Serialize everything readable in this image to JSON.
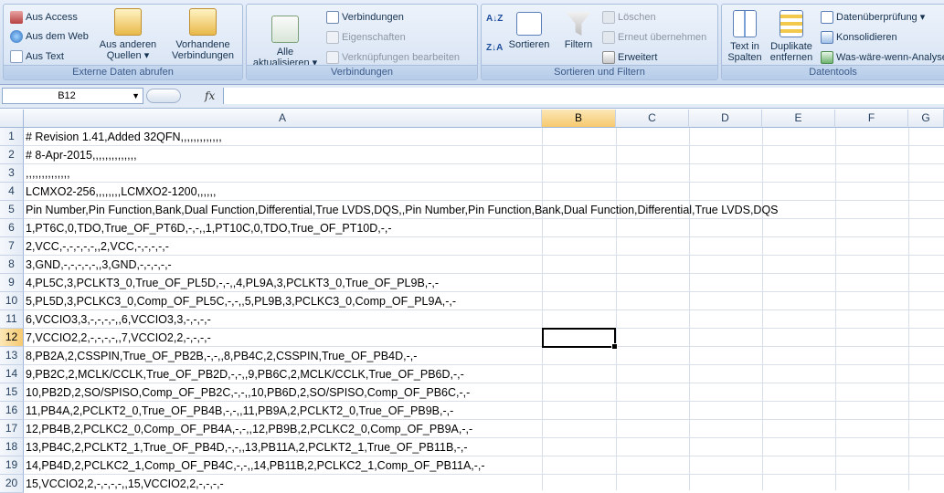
{
  "ribbon": {
    "external": {
      "title": "Externe Daten abrufen",
      "access": "Aus Access",
      "web": "Aus dem Web",
      "text": "Aus Text",
      "other_line1": "Aus anderen",
      "other_line2": "Quellen ▾",
      "existing_line1": "Vorhandene",
      "existing_line2": "Verbindungen"
    },
    "connections": {
      "title": "Verbindungen",
      "refresh_line1": "Alle",
      "refresh_line2": "aktualisieren ▾",
      "connections": "Verbindungen",
      "properties": "Eigenschaften",
      "edit_links": "Verknüpfungen bearbeiten"
    },
    "sort": {
      "title": "Sortieren und Filtern",
      "sort": "Sortieren",
      "filter": "Filtern",
      "clear": "Löschen",
      "reapply": "Erneut übernehmen",
      "advanced": "Erweitert"
    },
    "tools": {
      "title": "Datentools",
      "text_to_cols_line1": "Text in",
      "text_to_cols_line2": "Spalten",
      "dup_line1": "Duplikate",
      "dup_line2": "entfernen",
      "validation": "Datenüberprüfung ▾",
      "consolidate": "Konsolidieren",
      "whatif": "Was-wäre-wenn-Analyse"
    }
  },
  "formula_bar": {
    "name_box": "B12",
    "fx": "fx",
    "content": ""
  },
  "columns": [
    "A",
    "B",
    "C",
    "D",
    "E",
    "F",
    "G"
  ],
  "selected_column": "B",
  "selected_row": "12",
  "rows": [
    {
      "n": "1",
      "a": "# Revision 1.41,Added 32QFN,,,,,,,,,,,,,"
    },
    {
      "n": "2",
      "a": "# 8-Apr-2015,,,,,,,,,,,,,,"
    },
    {
      "n": "3",
      "a": ",,,,,,,,,,,,,,"
    },
    {
      "n": "4",
      "a": "LCMXO2-256,,,,,,,,LCMXO2-1200,,,,,,"
    },
    {
      "n": "5",
      "a": "Pin Number,Pin Function,Bank,Dual Function,Differential,True LVDS,DQS,,Pin Number,Pin Function,Bank,Dual Function,Differential,True LVDS,DQS"
    },
    {
      "n": "6",
      "a": "1,PT6C,0,TDO,True_OF_PT6D,-,-,,1,PT10C,0,TDO,True_OF_PT10D,-,-"
    },
    {
      "n": "7",
      "a": "2,VCC,-,-,-,-,-,,2,VCC,-,-,-,-,-"
    },
    {
      "n": "8",
      "a": "3,GND,-,-,-,-,-,,3,GND,-,-,-,-,-"
    },
    {
      "n": "9",
      "a": "4,PL5C,3,PCLKT3_0,True_OF_PL5D,-,-,,4,PL9A,3,PCLKT3_0,True_OF_PL9B,-,-"
    },
    {
      "n": "10",
      "a": "5,PL5D,3,PCLKC3_0,Comp_OF_PL5C,-,-,,5,PL9B,3,PCLKC3_0,Comp_OF_PL9A,-,-"
    },
    {
      "n": "11",
      "a": "6,VCCIO3,3,-,-,-,-,,6,VCCIO3,3,-,-,-,-"
    },
    {
      "n": "12",
      "a": "7,VCCIO2,2,-,-,-,-,,7,VCCIO2,2,-,-,-,-"
    },
    {
      "n": "13",
      "a": "8,PB2A,2,CSSPIN,True_OF_PB2B,-,-,,8,PB4C,2,CSSPIN,True_OF_PB4D,-,-"
    },
    {
      "n": "14",
      "a": "9,PB2C,2,MCLK/CCLK,True_OF_PB2D,-,-,,9,PB6C,2,MCLK/CCLK,True_OF_PB6D,-,-"
    },
    {
      "n": "15",
      "a": "10,PB2D,2,SO/SPISO,Comp_OF_PB2C,-,-,,10,PB6D,2,SO/SPISO,Comp_OF_PB6C,-,-"
    },
    {
      "n": "16",
      "a": "11,PB4A,2,PCLKT2_0,True_OF_PB4B,-,-,,11,PB9A,2,PCLKT2_0,True_OF_PB9B,-,-"
    },
    {
      "n": "17",
      "a": "12,PB4B,2,PCLKC2_0,Comp_OF_PB4A,-,-,,12,PB9B,2,PCLKC2_0,Comp_OF_PB9A,-,-"
    },
    {
      "n": "18",
      "a": "13,PB4C,2,PCLKT2_1,True_OF_PB4D,-,-,,13,PB11A,2,PCLKT2_1,True_OF_PB11B,-,-"
    },
    {
      "n": "19",
      "a": "14,PB4D,2,PCLKC2_1,Comp_OF_PB4C,-,-,,14,PB11B,2,PCLKC2_1,Comp_OF_PB11A,-,-"
    },
    {
      "n": "20",
      "a": "15,VCCIO2,2,-,-,-,-,,15,VCCIO2,2,-,-,-,-"
    }
  ]
}
